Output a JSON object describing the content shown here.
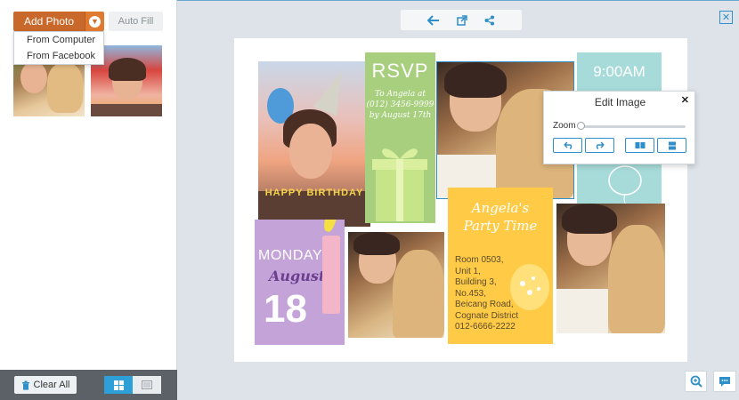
{
  "left_panel": {
    "add_photo_label": "Add Photo",
    "auto_fill_label": "Auto Fill",
    "dropdown": [
      "From Computer",
      "From Facebook"
    ],
    "clear_all_label": "Clear All"
  },
  "canvas": {
    "rsvp": {
      "title": "RSVP",
      "line1": "To Angela at",
      "line2": "(012) 3456-9999",
      "line3": "by August 17th"
    },
    "time": "9:00AM",
    "monday": {
      "day": "MONDAY",
      "month": "August",
      "date": "18"
    },
    "party": {
      "title1": "Angela's",
      "title2": "Party Time",
      "address": [
        "Room 0503,",
        "Unit 1,",
        "Building 3,",
        "No.453,",
        "Beicang Road,",
        "Cognate District",
        "012-6666-2222"
      ]
    },
    "candles_text": "HAPPY BIRTHDAY"
  },
  "edit_popup": {
    "title": "Edit Image",
    "zoom_label": "Zoom",
    "zoom_level": 0
  },
  "colors": {
    "accent": "#2f8fc8",
    "orange": "#c8682a",
    "rsvp_green": "#a7cf7e",
    "teal": "#a7dbd9",
    "purple": "#c4a4d8",
    "yellow": "#ffcb47"
  }
}
